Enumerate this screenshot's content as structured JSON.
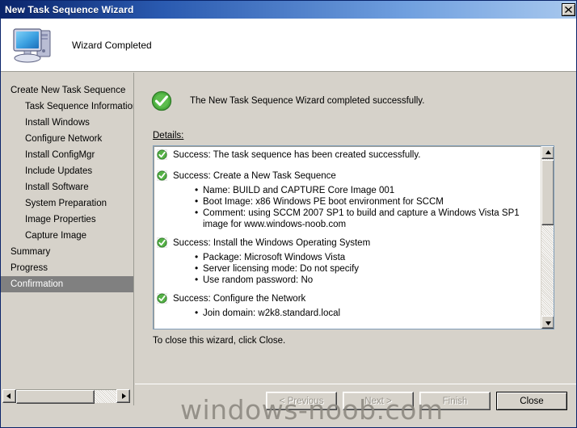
{
  "window": {
    "title": "New Task Sequence Wizard",
    "close_icon": "close-x-icon"
  },
  "header": {
    "title": "Wizard Completed",
    "icon": "computer-monitor-icon"
  },
  "sidebar": {
    "items": [
      {
        "label": "Create New Task Sequence",
        "level": 0,
        "selected": false
      },
      {
        "label": "Task Sequence Information",
        "level": 1,
        "selected": false
      },
      {
        "label": "Install Windows",
        "level": 1,
        "selected": false
      },
      {
        "label": "Configure Network",
        "level": 1,
        "selected": false
      },
      {
        "label": "Install ConfigMgr",
        "level": 1,
        "selected": false
      },
      {
        "label": "Include Updates",
        "level": 1,
        "selected": false
      },
      {
        "label": "Install Software",
        "level": 1,
        "selected": false
      },
      {
        "label": "System Preparation",
        "level": 1,
        "selected": false
      },
      {
        "label": "Image Properties",
        "level": 1,
        "selected": false
      },
      {
        "label": "Capture Image",
        "level": 1,
        "selected": false
      },
      {
        "label": "Summary",
        "level": 0,
        "selected": false
      },
      {
        "label": "Progress",
        "level": 0,
        "selected": false
      },
      {
        "label": "Confirmation",
        "level": 0,
        "selected": true
      }
    ],
    "scrollbar": {
      "left_arrow_icon": "arrow-left-icon",
      "right_arrow_icon": "arrow-right-icon"
    }
  },
  "main": {
    "success_icon": "green-check-circle-icon",
    "success_message": "The New Task Sequence Wizard completed successfully.",
    "details_label": "Details:",
    "details": [
      {
        "icon": "green-check-small-icon",
        "heading": "Success: The task sequence has been created successfully.",
        "bullets": []
      },
      {
        "icon": "green-check-small-icon",
        "heading": "Success: Create a New Task Sequence",
        "bullets": [
          "Name: BUILD and CAPTURE Core Image 001",
          "Boot Image: x86 Windows PE boot environment for SCCM",
          "Comment: using SCCM 2007 SP1 to build and capture a Windows Vista SP1 image for www.windows-noob.com"
        ]
      },
      {
        "icon": "green-check-small-icon",
        "heading": "Success: Install the Windows Operating System",
        "bullets": [
          "Package: Microsoft Windows Vista",
          "Server licensing mode: Do not specify",
          "Use random password: No"
        ]
      },
      {
        "icon": "green-check-small-icon",
        "heading": "Success: Configure the Network",
        "bullets": [
          "Join domain: w2k8.standard.local"
        ]
      }
    ],
    "details_scrollbar": {
      "up_arrow_icon": "arrow-up-icon",
      "down_arrow_icon": "arrow-down-icon"
    },
    "close_hint": "To close this wizard, click Close."
  },
  "footer": {
    "buttons": [
      {
        "label": "< Previous",
        "disabled": true,
        "default": false,
        "name": "previous-button"
      },
      {
        "label": "Next >",
        "disabled": true,
        "default": false,
        "name": "next-button"
      },
      {
        "label": "Finish",
        "disabled": true,
        "default": false,
        "name": "finish-button"
      },
      {
        "label": "Close",
        "disabled": false,
        "default": true,
        "name": "close-button"
      }
    ]
  },
  "watermark": "windows-noob.com",
  "colors": {
    "titlebar_start": "#0a246a",
    "titlebar_end": "#a8c8ee",
    "face": "#d6d2ca",
    "selection": "#808080",
    "success_green": "#3d9b35",
    "watermark": "#8b8880"
  }
}
